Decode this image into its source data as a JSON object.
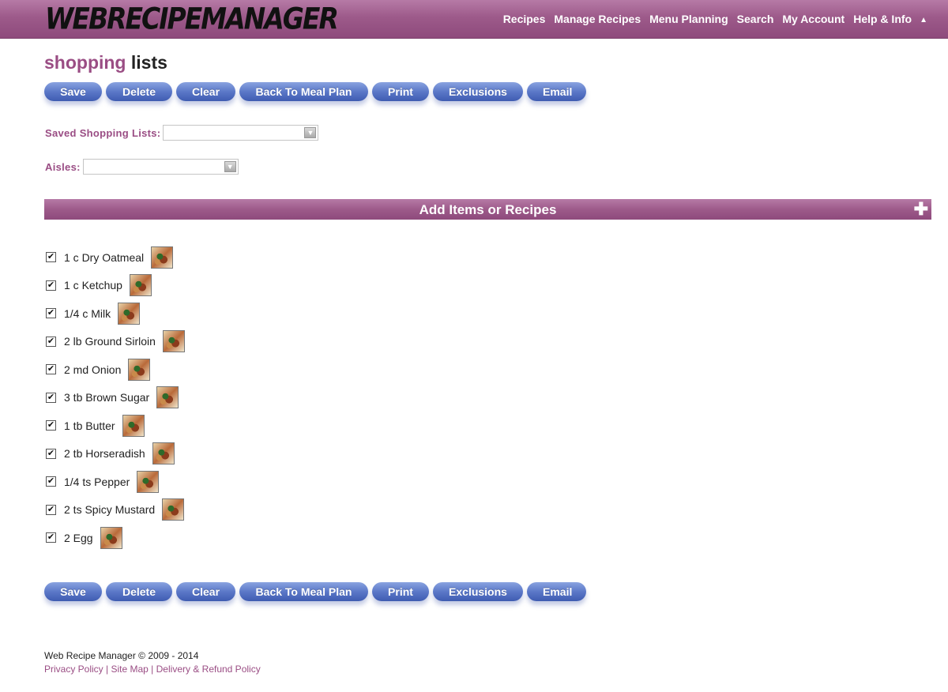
{
  "header": {
    "logo": "WEBRECIPEMANAGER",
    "nav": [
      "Recipes",
      "Manage Recipes",
      "Menu Planning",
      "Search",
      "My Account",
      "Help & Info"
    ],
    "caret": "▲"
  },
  "page": {
    "title_part1": "shopping",
    "title_part2": "lists"
  },
  "buttons": [
    "Save",
    "Delete",
    "Clear",
    "Back To Meal Plan",
    "Print",
    "Exclusions",
    "Email"
  ],
  "fields": {
    "saved_lists_label": "Saved Shopping Lists:",
    "saved_lists_value": "",
    "aisles_label": "Aisles:",
    "aisles_value": ""
  },
  "add_bar": {
    "label": "Add Items or Recipes",
    "icon": "plus-icon"
  },
  "items": [
    {
      "text": "1 c Dry Oatmeal",
      "checked": true
    },
    {
      "text": "1 c Ketchup",
      "checked": true
    },
    {
      "text": "1/4 c Milk",
      "checked": true
    },
    {
      "text": "2 lb Ground Sirloin",
      "checked": true
    },
    {
      "text": "2 md Onion",
      "checked": true
    },
    {
      "text": "3 tb Brown Sugar",
      "checked": true
    },
    {
      "text": "1 tb Butter",
      "checked": true
    },
    {
      "text": "2 tb Horseradish",
      "checked": true
    },
    {
      "text": "1/4 ts Pepper",
      "checked": true
    },
    {
      "text": "2 ts Spicy Mustard",
      "checked": true
    },
    {
      "text": "2 Egg",
      "checked": true
    }
  ],
  "footer": {
    "copyright": "Web Recipe Manager © 2009 - 2014",
    "links": [
      "Privacy Policy",
      "Site Map",
      "Delivery & Refund Policy"
    ],
    "separator": " | "
  },
  "colors": {
    "brand": "#9d5a8a",
    "button": "#5b78c8"
  }
}
